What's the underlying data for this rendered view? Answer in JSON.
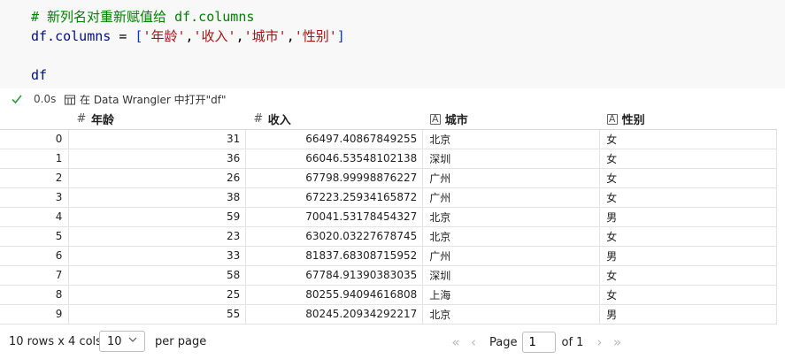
{
  "code": {
    "comment": "# 新列名对重新赋值给 df.columns",
    "assign_lhs": "df.columns",
    "assign_op": " = ",
    "open_bracket": "[",
    "close_bracket": "]",
    "columns_list": [
      "'年龄'",
      "'收入'",
      "'城市'",
      "'性别'"
    ],
    "comma": ",",
    "last_line": "df"
  },
  "status": {
    "duration": "0.0s",
    "wrangler_label": "在 Data Wrangler 中打开\"df\""
  },
  "table": {
    "headers": [
      {
        "label": "年龄",
        "type_icon": "#"
      },
      {
        "label": "收入",
        "type_icon": "#"
      },
      {
        "label": "城市",
        "type_icon": "A"
      },
      {
        "label": "性别",
        "type_icon": "A"
      }
    ],
    "rows": [
      {
        "index": "0",
        "age": "31",
        "income": "66497.40867849255",
        "city": "北京",
        "gender": "女"
      },
      {
        "index": "1",
        "age": "36",
        "income": "66046.53548102138",
        "city": "深圳",
        "gender": "女"
      },
      {
        "index": "2",
        "age": "26",
        "income": "67798.99998876227",
        "city": "广州",
        "gender": "女"
      },
      {
        "index": "3",
        "age": "38",
        "income": "67223.25934165872",
        "city": "广州",
        "gender": "女"
      },
      {
        "index": "4",
        "age": "59",
        "income": "70041.53178454327",
        "city": "北京",
        "gender": "男"
      },
      {
        "index": "5",
        "age": "23",
        "income": "63020.03227678745",
        "city": "北京",
        "gender": "女"
      },
      {
        "index": "6",
        "age": "33",
        "income": "81837.68308715952",
        "city": "广州",
        "gender": "男"
      },
      {
        "index": "7",
        "age": "58",
        "income": "67784.91390383035",
        "city": "深圳",
        "gender": "女"
      },
      {
        "index": "8",
        "age": "25",
        "income": "80255.94094616808",
        "city": "上海",
        "gender": "女"
      },
      {
        "index": "9",
        "age": "55",
        "income": "80245.20934292217",
        "city": "北京",
        "gender": "男"
      }
    ]
  },
  "footer": {
    "rows_info": "10 rows x 4 cols",
    "page_size": "10",
    "per_page": "per page",
    "page_label": "Page",
    "page_value": "1",
    "of_label": "of 1",
    "first_glyph": "«",
    "prev_glyph": "‹",
    "next_glyph": "›",
    "last_glyph": "»"
  },
  "icons": {
    "check": "check-icon",
    "wrangler": "data-wrangler-icon",
    "number_type": "number-type-icon",
    "text_type": "text-type-icon",
    "chevron": "chevron-down-icon"
  },
  "colors": {
    "comment": "#008000",
    "string": "#a31515",
    "name": "#001080",
    "bracket": "#0431fa",
    "check": "#2e9e44"
  }
}
